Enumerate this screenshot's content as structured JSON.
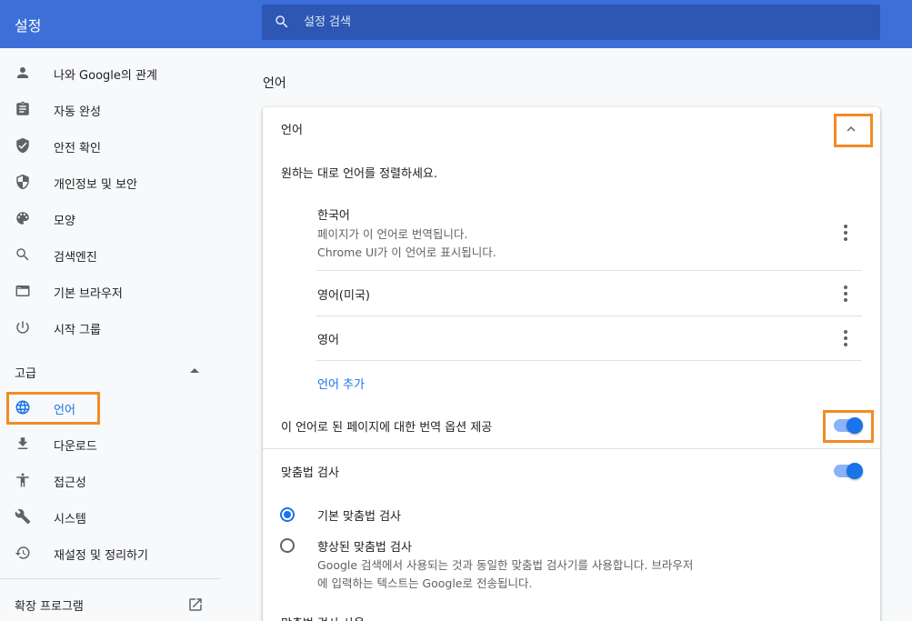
{
  "header": {
    "title": "설정",
    "search_placeholder": "설정 검색"
  },
  "sidebar": {
    "items": [
      {
        "label": "나와 Google의 관계",
        "icon": "person-icon"
      },
      {
        "label": "자동 완성",
        "icon": "clipboard-icon"
      },
      {
        "label": "안전 확인",
        "icon": "shield-check-icon"
      },
      {
        "label": "개인정보 및 보안",
        "icon": "shield-icon"
      },
      {
        "label": "모양",
        "icon": "palette-icon"
      },
      {
        "label": "검색엔진",
        "icon": "search-icon"
      },
      {
        "label": "기본 브라우저",
        "icon": "browser-window-icon"
      },
      {
        "label": "시작 그룹",
        "icon": "power-icon"
      }
    ],
    "advanced_label": "고급",
    "advanced_items": [
      {
        "label": "언어",
        "icon": "globe-icon",
        "active": true
      },
      {
        "label": "다운로드",
        "icon": "download-icon"
      },
      {
        "label": "접근성",
        "icon": "accessibility-icon"
      },
      {
        "label": "시스템",
        "icon": "wrench-icon"
      },
      {
        "label": "재설정 및 정리하기",
        "icon": "history-icon"
      }
    ],
    "extensions_label": "확장 프로그램"
  },
  "main": {
    "section_title": "언어",
    "card": {
      "languages_header": "언어",
      "order_description": "원하는 대로 언어를 정렬하세요.",
      "languages": [
        {
          "name": "한국어",
          "details": [
            "페이지가 이 언어로 번역됩니다.",
            "Chrome UI가 이 언어로 표시됩니다."
          ]
        },
        {
          "name": "영어(미국)",
          "details": []
        },
        {
          "name": "영어",
          "details": []
        }
      ],
      "add_language": "언어 추가",
      "translate_offer": "이 언어로 된 페이지에 대한 번역 옵션 제공",
      "translate_enabled": true,
      "spellcheck_label": "맞춤법 검사",
      "spellcheck_enabled": true,
      "spellcheck_options": [
        {
          "label": "기본 맞춤법 검사",
          "checked": true,
          "description": []
        },
        {
          "label": "향상된 맞춤법 검사",
          "checked": false,
          "description": [
            "Google 검색에서 사용되는 것과 동일한 맞춤법 검사기를 사용합니다. 브라우저",
            "에 입력하는 텍스트는 Google로 전송됩니다."
          ]
        }
      ],
      "spellcheck_usage_label": "맞춤법 검사 사용"
    }
  },
  "colors": {
    "header_bg": "#3c6fd8",
    "search_bg": "#2d57b3",
    "accent": "#1a73e8",
    "highlight": "#f28b25"
  }
}
